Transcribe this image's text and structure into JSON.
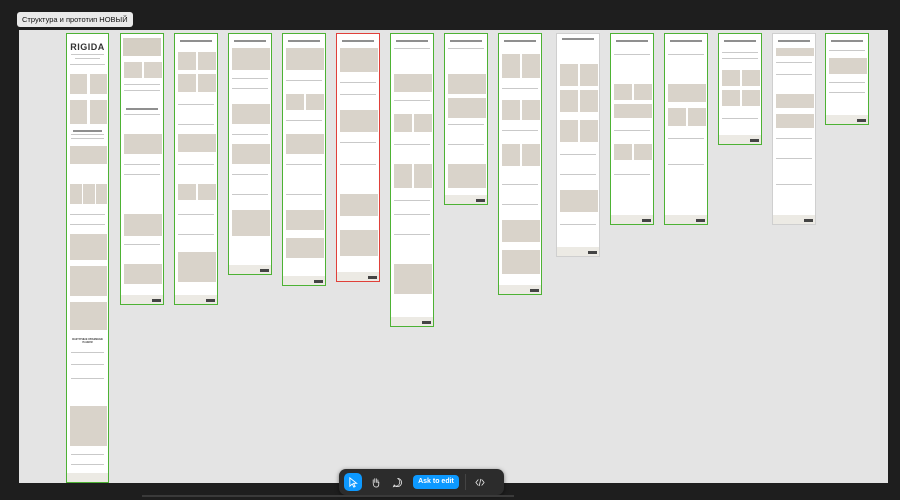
{
  "file_title": "Структура и прототип НОВЫЙ",
  "frames": [
    {
      "id": "main",
      "logo": "RIGIDA",
      "section": "ФАКТУРНЫЕ ОБЪЕМНЫЕ ПАНЕЛИ",
      "status": "ready"
    },
    {
      "id": "f2",
      "status": "ready"
    },
    {
      "id": "f3",
      "status": "ready"
    },
    {
      "id": "f4",
      "status": "ready"
    },
    {
      "id": "f5",
      "status": "ready"
    },
    {
      "id": "f6",
      "status": "selected"
    },
    {
      "id": "f7",
      "status": "ready"
    },
    {
      "id": "f8",
      "status": "ready"
    },
    {
      "id": "f9",
      "status": "ready"
    },
    {
      "id": "f10",
      "status": "draft"
    },
    {
      "id": "f11",
      "status": "ready"
    },
    {
      "id": "f12",
      "status": "ready"
    },
    {
      "id": "f13",
      "status": "ready"
    },
    {
      "id": "f14",
      "status": "draft"
    },
    {
      "id": "f15",
      "status": "ready"
    }
  ],
  "toolbar": {
    "tools": [
      {
        "name": "move-tool",
        "active": true
      },
      {
        "name": "hand-tool",
        "active": false
      },
      {
        "name": "comment-tool",
        "active": false
      }
    ],
    "ask_label": "Ask to edit",
    "dev_mode": "code-icon"
  },
  "colors": {
    "canvas": "#e4e4e4",
    "frame_ready_border": "#4db234",
    "frame_selected_border": "#e0403a",
    "placeholder": "#d9d3ca",
    "accent": "#0d99ff"
  }
}
